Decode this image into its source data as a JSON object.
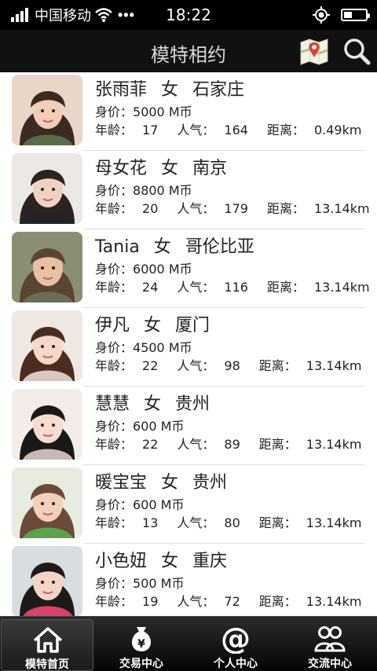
{
  "status_bar": {
    "carrier": "中国移动",
    "dots": "•••",
    "time": "18:22",
    "battery_level": 0.4
  },
  "header": {
    "title": "模特相约",
    "map_icon": "map-icon",
    "search_icon": "search-icon"
  },
  "models": [
    {
      "name": "张雨菲",
      "gender": "女",
      "city": "石家庄",
      "price_label": "身价：",
      "price": "5000 M币",
      "age_label": "年龄：",
      "age": "17",
      "pop_label": "人气：",
      "popularity": "164",
      "dist_label": "距离：",
      "distance": "0.49km"
    },
    {
      "name": "母女花",
      "gender": "女",
      "city": "南京",
      "price_label": "身价：",
      "price": "8800 M币",
      "age_label": "年龄：",
      "age": "20",
      "pop_label": "人气：",
      "popularity": "179",
      "dist_label": "距离：",
      "distance": "13.14km"
    },
    {
      "name": "Tania",
      "gender": "女",
      "city": "哥伦比亚",
      "price_label": "身价：",
      "price": "6000 M币",
      "age_label": "年龄：",
      "age": "24",
      "pop_label": "人气：",
      "popularity": "116",
      "dist_label": "距离：",
      "distance": "13.14km"
    },
    {
      "name": "伊凡",
      "gender": "女",
      "city": "厦门",
      "price_label": "身价：",
      "price": "4500 M币",
      "age_label": "年龄：",
      "age": "22",
      "pop_label": "人气：",
      "popularity": "98",
      "dist_label": "距离：",
      "distance": "13.14km"
    },
    {
      "name": "慧慧",
      "gender": "女",
      "city": "贵州",
      "price_label": "身价：",
      "price": "600 M币",
      "age_label": "年龄：",
      "age": "22",
      "pop_label": "人气：",
      "popularity": "89",
      "dist_label": "距离：",
      "distance": "13.14km"
    },
    {
      "name": "暖宝宝",
      "gender": "女",
      "city": "贵州",
      "price_label": "身价：",
      "price": "600 M币",
      "age_label": "年龄：",
      "age": "13",
      "pop_label": "人气：",
      "popularity": "80",
      "dist_label": "距离：",
      "distance": "13.14km"
    },
    {
      "name": "小色妞",
      "gender": "女",
      "city": "重庆",
      "price_label": "身价：",
      "price": "500 M币",
      "age_label": "年龄：",
      "age": "19",
      "pop_label": "人气：",
      "popularity": "72",
      "dist_label": "距离：",
      "distance": "13.14km"
    }
  ],
  "tabs": [
    {
      "label": "模特首页",
      "icon": "home-icon",
      "active": true
    },
    {
      "label": "交易中心",
      "icon": "money-bag-icon",
      "active": false
    },
    {
      "label": "个人中心",
      "icon": "at-sign-icon",
      "active": false
    },
    {
      "label": "交流中心",
      "icon": "community-icon",
      "active": false
    }
  ],
  "colors": {
    "header_bg": "#111111",
    "status_bg": "#000000",
    "title_text": "#d8d8d8",
    "tabbar_bg": "#1a1a1a"
  }
}
